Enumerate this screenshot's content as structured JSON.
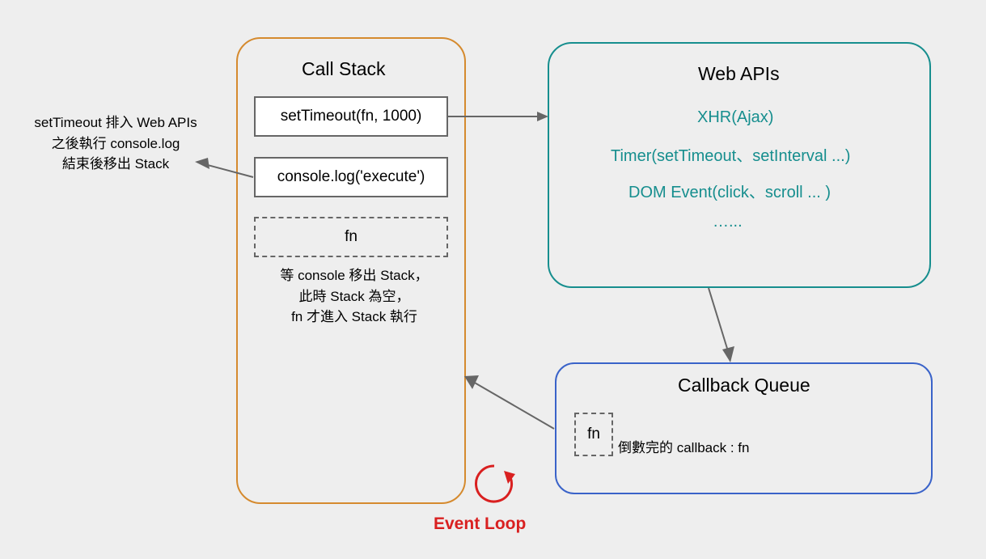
{
  "callStack": {
    "title": "Call Stack",
    "item1": "setTimeout(fn, 1000)",
    "item2": "console.log('execute')",
    "item3": "fn",
    "note": "等 console 移出 Stack，\n此時 Stack 為空，\nfn 才進入 Stack 執行"
  },
  "webApis": {
    "title": "Web APIs",
    "line1": "XHR(Ajax)",
    "line2": "Timer(setTimeout、setInterval ...)",
    "line3": "DOM Event(click、scroll ... )",
    "line4": "…..."
  },
  "callbackQueue": {
    "title": "Callback Queue",
    "item": "fn",
    "note": "倒數完的 callback : fn"
  },
  "leftNote": "setTimeout 排入 Web APIs\n之後執行 console.log\n結束後移出 Stack",
  "eventLoop": "Event Loop"
}
